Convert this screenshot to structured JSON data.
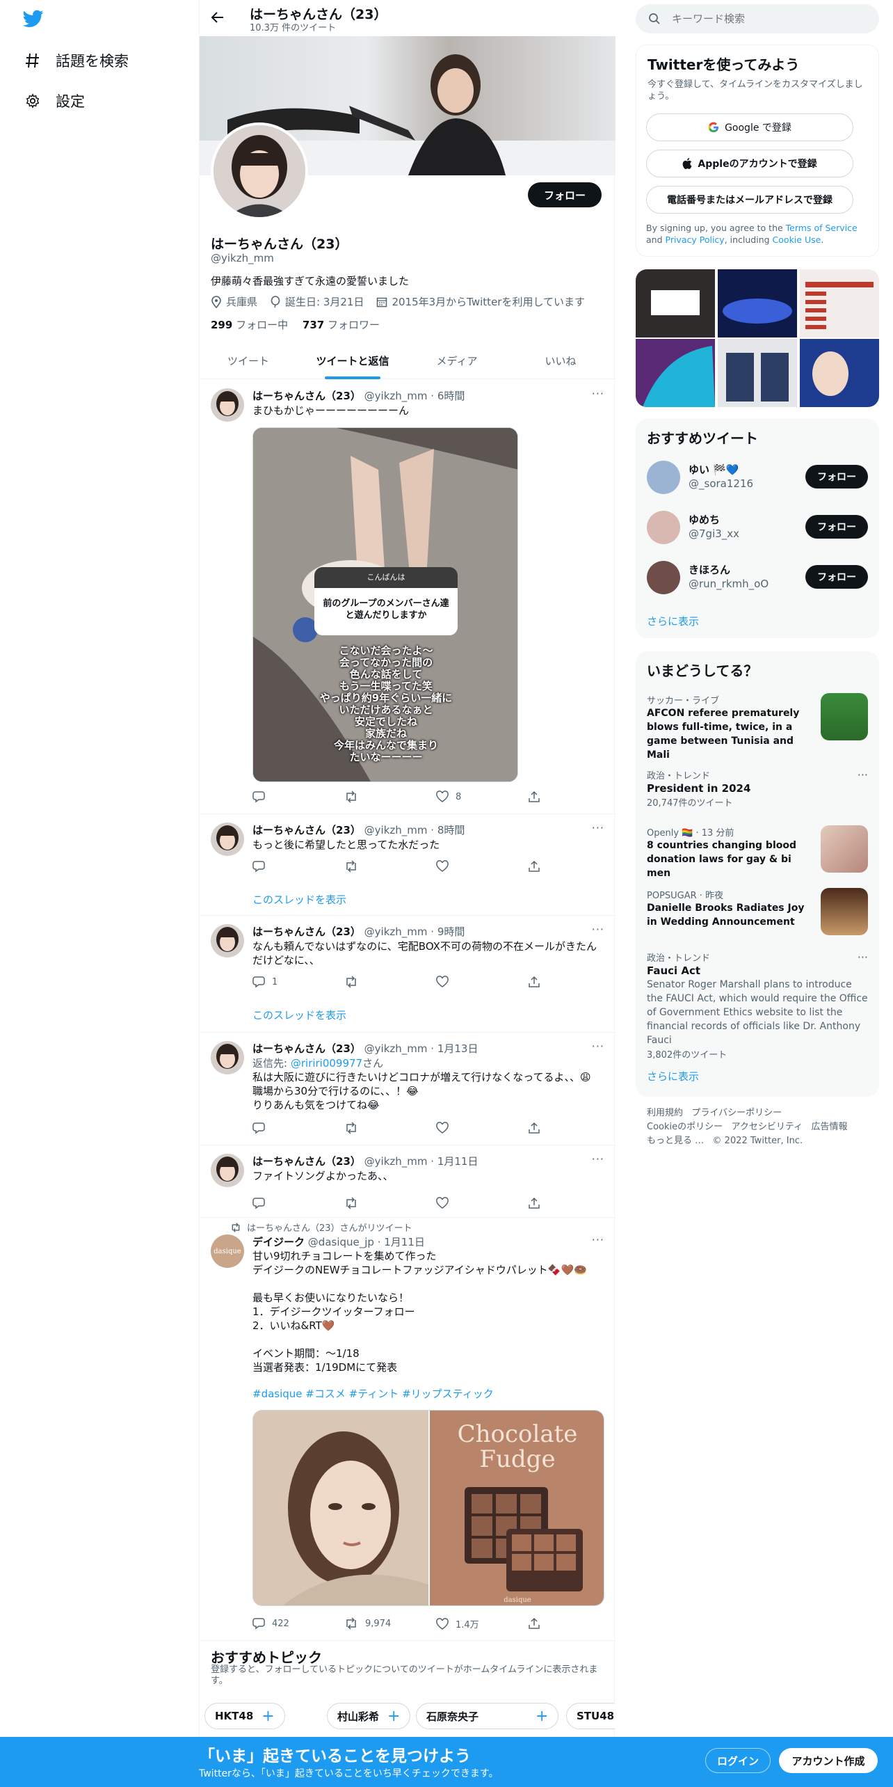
{
  "nav": {
    "explore_label": "話題を検索",
    "settings_label": "設定"
  },
  "header": {
    "name": "はーちゃんさん（23）",
    "tweet_count": "10.3万 件のツイート"
  },
  "profile": {
    "name": "はーちゃんさん（23）",
    "handle": "@yikzh_mm",
    "bio": "伊藤萌々香最強すぎて永遠の愛誓いました",
    "location": "兵庫県",
    "birthday": "誕生日: 3月21日",
    "joined": "2015年3月からTwitterを利用しています",
    "following_count": "299",
    "following_label": "フォロー中",
    "followers_count": "737",
    "followers_label": "フォロワー",
    "follow_button": "フォロー"
  },
  "tabs": [
    "ツイート",
    "ツイートと返信",
    "メディア",
    "いいね"
  ],
  "tweets": [
    {
      "name": "はーちゃんさん（23）",
      "handle": "@yikzh_mm",
      "time": "6時間",
      "text": "まひもかじゃーーーーーーーーん",
      "replies": "",
      "retweets": "",
      "likes": "8",
      "story": {
        "header": "こんばんは",
        "question": "前のグループのメンバーさん達\nと遊んだりしますか",
        "answer": "こないだ会ったよ～\n会ってなかった間の\n色んな話をして\nもう一生喋ってた笑\nやっぱり約9年ぐらい一緒に\nいただけあるなぁと\n安定でしたね\n家族だね\n今年はみんなで集まり\nたいなーーーー"
      }
    },
    {
      "name": "はーちゃんさん（23）",
      "handle": "@yikzh_mm",
      "time": "8時間",
      "text": "もっと後に希望したと思ってた水だった",
      "thread": "このスレッドを表示"
    },
    {
      "name": "はーちゃんさん（23）",
      "handle": "@yikzh_mm",
      "time": "9時間",
      "text": "なんも頼んでないはずなのに、宅配BOX不可の荷物の不在メールがきたんだけどなに、、",
      "replies": "1",
      "thread": "このスレッドを表示"
    },
    {
      "name": "はーちゃんさん（23）",
      "handle": "@yikzh_mm",
      "time": "1月13日",
      "reply_prefix": "返信先: ",
      "reply_to": "@ririri009977",
      "reply_suffix": "さん",
      "text": "私は大阪に遊びに行きたいけどコロナが増えて行けなくなってるよ、、😩\n職場から30分で行けるのに、、！😂\nりりあんも気をつけてね😂"
    },
    {
      "name": "はーちゃんさん（23）",
      "handle": "@yikzh_mm",
      "time": "1月11日",
      "text": "ファイトソングよかったあ、、"
    },
    {
      "retweet_label": "はーちゃんさん（23）さんがリツイート",
      "name": "デイジーク",
      "handle": "@dasique_jp",
      "time": "1月11日",
      "avatar_text": "dasique",
      "text": "甘い9切れチョコレートを集めて作った\nデイジークのNEWチョコレートファッジアイシャドウパレット🍫🤎🍩\n\n最も早くお使いになりたいなら！\n1．デイジークツイッターフォロー\n2．いいね&RT🤎\n\nイベント期間：～1/18\n当選者発表：1/19DMにて発表",
      "hashtags": "#dasique #コスメ #ティント #リップスティック",
      "product_title": "Chocolate\nFudge",
      "product_brand": "dasique",
      "replies": "422",
      "retweets": "9,974",
      "likes": "1.4万"
    }
  ],
  "topics": {
    "title": "おすすめトピック",
    "subtitle": "登録すると、フォローしているトピックについてのツイートがホームタイムラインに表示されます。",
    "chips": [
      "HKT48",
      "村山彩希",
      "石原奈央子",
      "STU48"
    ]
  },
  "search": {
    "placeholder": "キーワード検索"
  },
  "signup": {
    "title": "Twitterを使ってみよう",
    "subtitle": "今すぐ登録して、タイムラインをカスタマイズしましょう。",
    "google": "Google で登録",
    "apple": "Appleのアカウントで登録",
    "phone": "電話番号またはメールアドレスで登録",
    "legal_1": "By signing up, you agree to the ",
    "terms": "Terms of Service",
    "legal_2": " and ",
    "privacy": "Privacy Policy",
    "legal_3": ", including ",
    "cookie": "Cookie Use",
    "legal_4": "."
  },
  "recommend": {
    "title": "おすすめツイート",
    "users": [
      {
        "name": "ゆい 🏁💙",
        "handle": "@_sora1216"
      },
      {
        "name": "ゆめち",
        "handle": "@7gi3_xx"
      },
      {
        "name": "きほろん",
        "handle": "@run_rkmh_oO"
      }
    ],
    "follow": "フォロー",
    "more": "さらに表示"
  },
  "trends": {
    "title": "いまどうしてる？",
    "items": [
      {
        "cat": "サッカー・ライブ",
        "title": "AFCON referee prematurely blows full-time, twice, in a game between Tunisia and Mali"
      },
      {
        "cat": "政治・トレンド",
        "title": "President in 2024",
        "count": "20,747件のツイート"
      },
      {
        "cat": "Openly 🏳️‍🌈 · 13 分前",
        "title": "8 countries changing blood donation laws for gay & bi men"
      },
      {
        "cat": "POPSUGAR · 昨夜",
        "title": "Danielle Brooks Radiates Joy in Wedding Announcement"
      },
      {
        "cat": "政治・トレンド",
        "title": "Fauci Act",
        "desc": "Senator Roger Marshall plans to introduce the FAUCI Act, which would require the Office of Government Ethics website to list the financial records of officials like Dr. Anthony Fauci",
        "count": "3,802件のツイート"
      }
    ],
    "more": "さらに表示"
  },
  "footer": {
    "terms": "利用規約",
    "privacy": "プライバシーポリシー",
    "cookie": "Cookieのポリシー",
    "accessibility": "アクセシビリティ",
    "ads": "広告情報",
    "more": "もっと見る …",
    "copyright": "© 2022 Twitter, Inc."
  },
  "bottom": {
    "headline": "「いま」起きていることを見つけよう",
    "sub": "Twitterなら、「いま」起きていることをいち早くチェックできます。",
    "login": "ログイン",
    "signup": "アカウント作成"
  },
  "colors": {
    "accent": "#1d9bf0",
    "text": "#0f1419",
    "muted": "#536471"
  }
}
